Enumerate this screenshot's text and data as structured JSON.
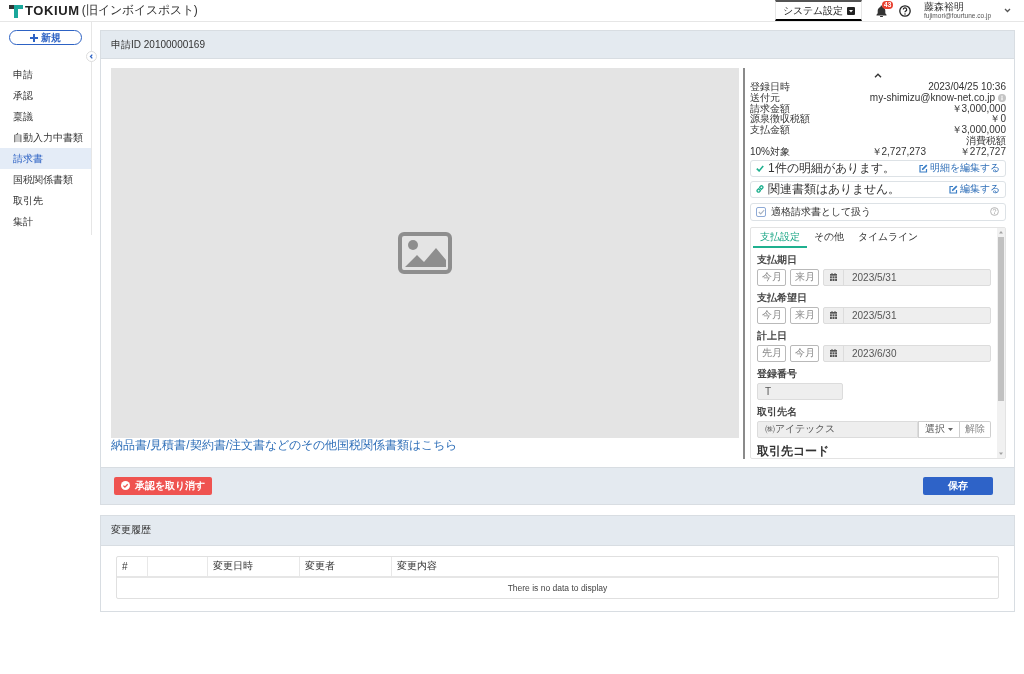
{
  "header": {
    "logo": {
      "brand": "TOKIUM",
      "subtitle": "(旧インボイスポスト)"
    },
    "system_menu": "システム設定",
    "notification_count": "43",
    "user": {
      "name": "藤森裕明",
      "email": "fujimori@fourtune.co.jp"
    }
  },
  "sidebar": {
    "new_button": "新規",
    "items": [
      {
        "label": "申請",
        "selected": false
      },
      {
        "label": "承認",
        "selected": false
      },
      {
        "label": "稟議",
        "selected": false
      },
      {
        "label": "自動入力中書類",
        "selected": false
      },
      {
        "label": "請求書",
        "selected": true
      },
      {
        "label": "国税関係書類",
        "selected": false
      },
      {
        "label": "取引先",
        "selected": false
      },
      {
        "label": "集計",
        "selected": false
      }
    ]
  },
  "request": {
    "title": "申請ID 20100000169",
    "other_documents_link": "納品書/見積書/契約書/注文書などのその他国税関係書類はこちら",
    "summary": {
      "rows": [
        {
          "kind": "plain",
          "label": "登録日時",
          "value": "2023/04/25 10:36"
        },
        {
          "kind": "info",
          "label": "送付元",
          "value": "my-shimizu@know-net.co.jp"
        },
        {
          "kind": "plain",
          "label": "請求金額",
          "value": "￥3,000,000"
        },
        {
          "kind": "plain",
          "label": "源泉徴収税額",
          "value": "￥0"
        },
        {
          "kind": "plain",
          "label": "支払金額",
          "value": "￥3,000,000"
        }
      ],
      "tax_heading": "消費税額",
      "tax_rows": [
        {
          "label": "10%対象",
          "base": "￥2,727,273",
          "tax": "￥272,727"
        }
      ]
    },
    "notices": [
      {
        "kind": "details",
        "text": "1件の明細があります。",
        "action": "明細を編集する"
      },
      {
        "kind": "related",
        "text": "関連書類はありません。",
        "action": "編集する"
      }
    ],
    "qualified_invoice": {
      "label": "適格請求書として扱う",
      "checked": true
    },
    "tabs": [
      {
        "label": "支払設定",
        "selected": true
      },
      {
        "label": "その他",
        "selected": false
      },
      {
        "label": "タイムライン",
        "selected": false
      }
    ],
    "fields": [
      {
        "kind": "date",
        "label": "支払期日",
        "shortcuts": [
          "今月",
          "来月"
        ],
        "value": "2023/5/31",
        "disabled": true
      },
      {
        "kind": "date",
        "label": "支払希望日",
        "shortcuts": [
          "今月",
          "来月"
        ],
        "value": "2023/5/31",
        "disabled": true
      },
      {
        "kind": "date",
        "label": "計上日",
        "shortcuts": [
          "先月",
          "今月"
        ],
        "value": "2023/6/30",
        "disabled": true
      },
      {
        "kind": "text",
        "label": "登録番号",
        "value": "T",
        "disabled": true
      },
      {
        "kind": "picker",
        "label": "取引先名",
        "value": "㈱アイテックス",
        "select": "選択",
        "clear": "解除",
        "disabled": true
      },
      {
        "kind": "heading",
        "label": "取引先コード"
      }
    ],
    "actions": {
      "cancel_approval": "承認を取り消す",
      "save": "保存"
    }
  },
  "history": {
    "title": "変更履歴",
    "columns": [
      {
        "kind": "text",
        "label": "#"
      },
      {
        "kind": "blank"
      },
      {
        "kind": "text",
        "label": "変更日時"
      },
      {
        "kind": "text",
        "label": "変更者"
      },
      {
        "kind": "text",
        "label": "変更内容"
      }
    ],
    "empty_message": "There is no data to display"
  }
}
